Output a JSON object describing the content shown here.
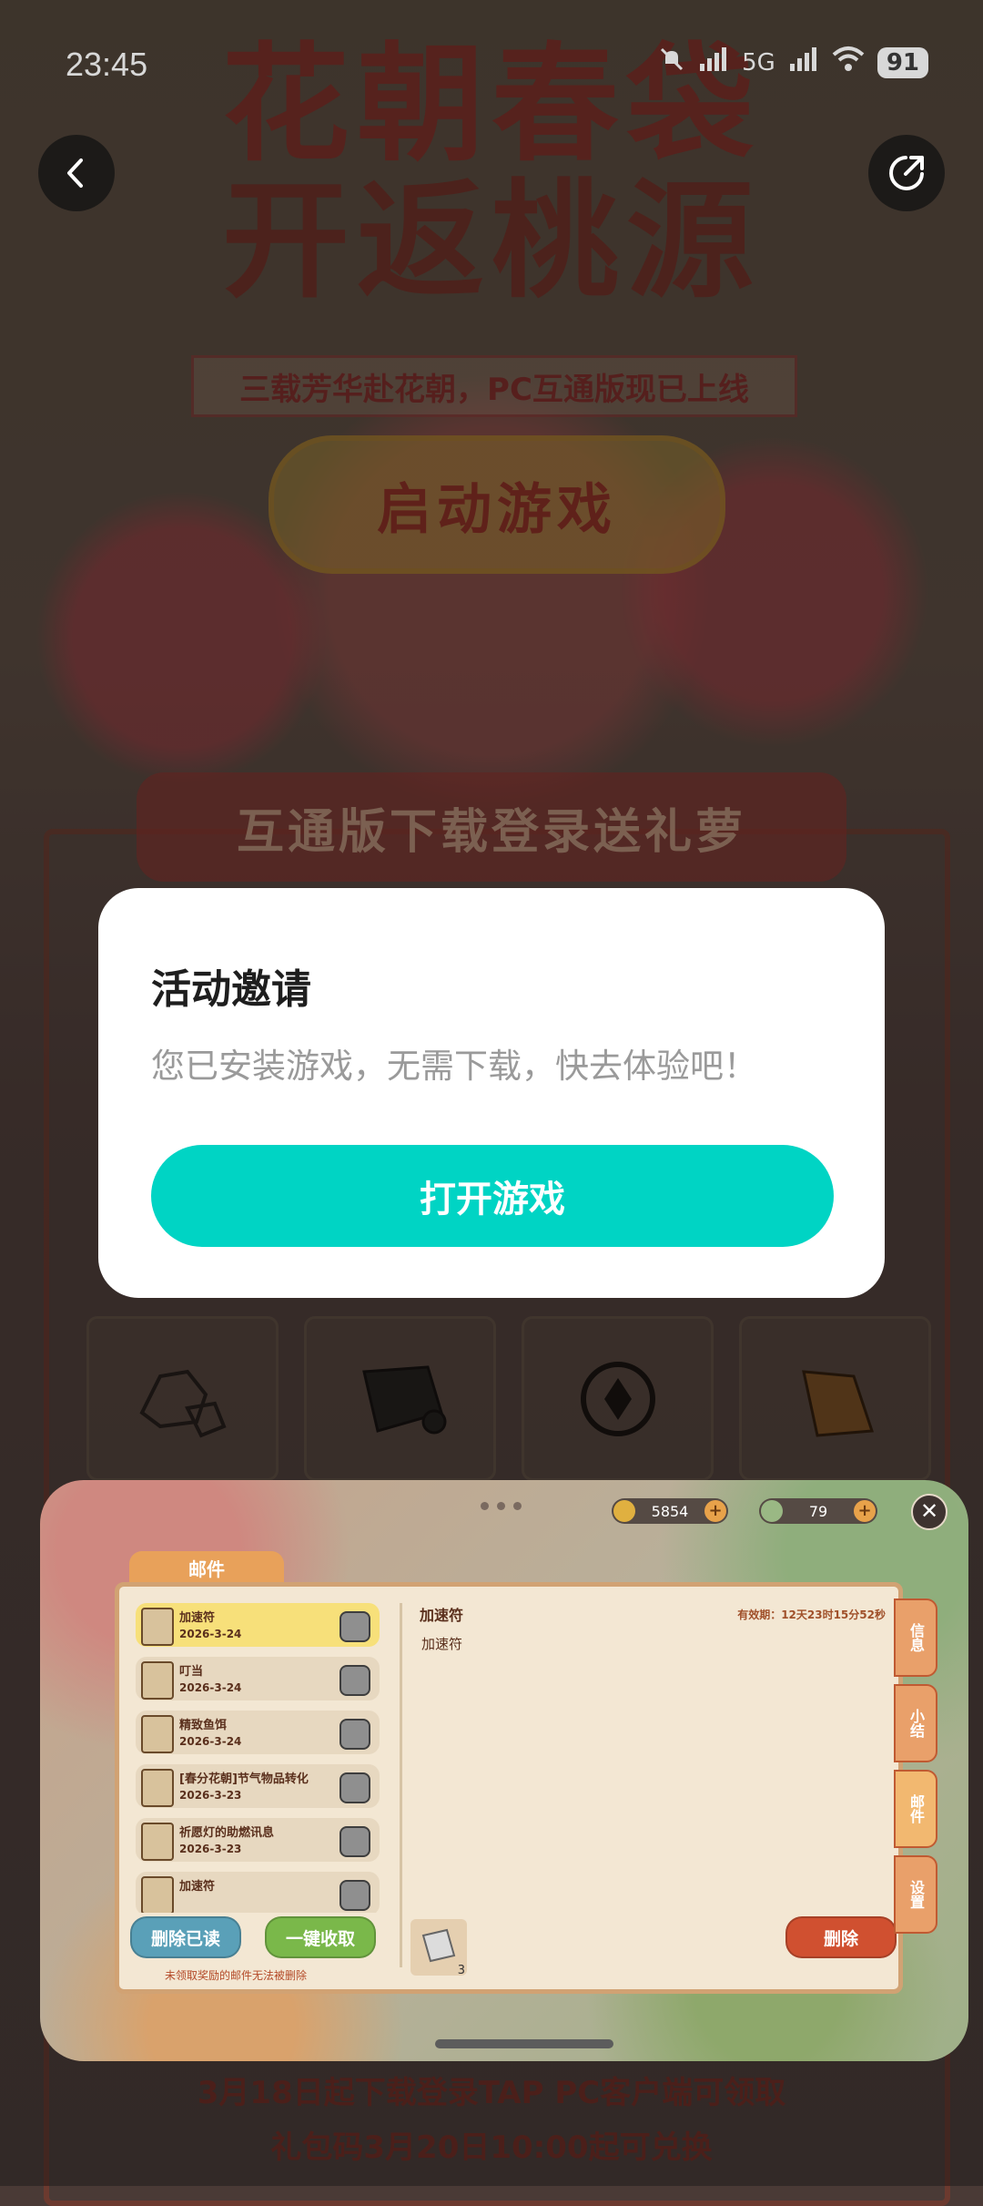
{
  "status_bar": {
    "time": "23:45",
    "network": "5G",
    "battery": "91"
  },
  "background": {
    "title_line1": "花朝春袋",
    "title_line2": "开返桃源",
    "subtitle": "三载芳华赴花朝，PC互通版现已上线",
    "start_button": "启动游戏",
    "download_banner": "互通版下载登录送礼萝",
    "bottom_line1": "3月18日起下载登录TAP PC客户端可领取",
    "bottom_line2": "礼包码3月20日10:00起可兑换"
  },
  "dialog": {
    "title": "活动邀请",
    "message": "您已安装游戏，无需下载，快去体验吧！",
    "button": "打开游戏"
  },
  "mini_game": {
    "currency_gold": "5854",
    "currency_gem": "79",
    "mail_tab": "邮件",
    "mails": [
      {
        "name": "加速符",
        "date": "2026-3-24",
        "selected": true
      },
      {
        "name": "叮当",
        "date": "2026-3-24",
        "selected": false
      },
      {
        "name": "精致鱼饵",
        "date": "2026-3-24",
        "selected": false
      },
      {
        "name": "[春分花朝]节气物品转化",
        "date": "2026-3-23",
        "selected": false
      },
      {
        "name": "祈愿灯的助燃讯息",
        "date": "2026-3-23",
        "selected": false
      },
      {
        "name": "加速符",
        "date": "",
        "selected": false
      }
    ],
    "detail_title": "加速符",
    "detail_expiry": "有效期：12天23时15分52秒",
    "detail_body": "加速符",
    "attachment_count": "3",
    "btn_delete_read": "删除已读",
    "btn_collect_all": "一键收取",
    "btn_delete": "删除",
    "notice": "未领取奖励的邮件无法被删除",
    "side_tabs": [
      "信息",
      "小结",
      "邮件",
      "设置"
    ]
  },
  "colors": {
    "accent": "#00d4c4",
    "dialog_bg": "#ffffff"
  }
}
